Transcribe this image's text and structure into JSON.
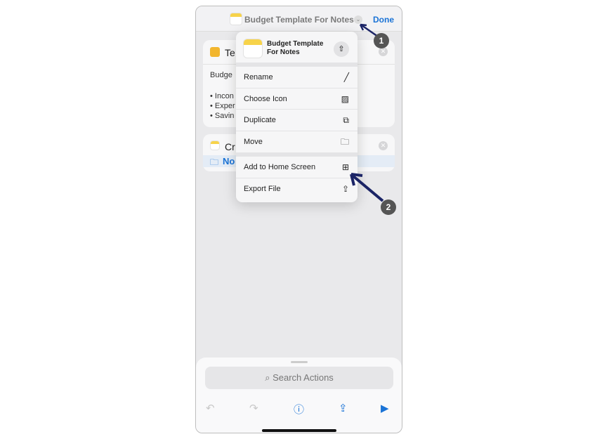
{
  "header": {
    "title": "Budget Template For Notes",
    "done_label": "Done"
  },
  "cards": {
    "text_title": "Te",
    "text_body": [
      "Budge",
      "• Incon",
      "• Exper",
      "• Savin"
    ],
    "create_title": "Cr",
    "folder": "No"
  },
  "menu": {
    "name_line1": "Budget Template",
    "name_line2": "For Notes",
    "items": [
      {
        "label": "Rename",
        "icon": "pencil-icon"
      },
      {
        "label": "Choose Icon",
        "icon": "photo-icon"
      },
      {
        "label": "Duplicate",
        "icon": "duplicate-icon"
      },
      {
        "label": "Move",
        "icon": "folder-icon"
      },
      {
        "label": "Add to Home Screen",
        "icon": "plus-square-icon"
      },
      {
        "label": "Export File",
        "icon": "export-icon"
      }
    ]
  },
  "sheet": {
    "search_placeholder": "Search Actions"
  },
  "annotations": [
    "1",
    "2"
  ],
  "colors": {
    "accent": "#1a73d6",
    "arrow": "#1b2466",
    "notes_yellow": "#f7d34a"
  }
}
